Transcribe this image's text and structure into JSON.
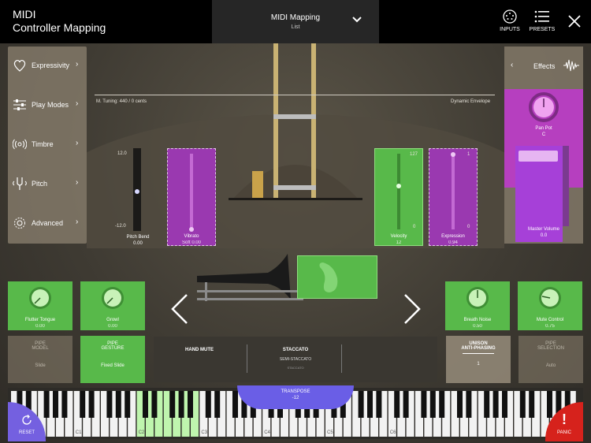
{
  "header": {
    "app_title_line1": "MIDI",
    "app_title_line2": "Controller Mapping",
    "mapping_title": "MIDI Mapping",
    "mapping_sub": "List",
    "inputs_label": "INPUTS",
    "presets_label": "PRESETS"
  },
  "sidebar": {
    "items": [
      {
        "label": "Expressivity",
        "icon": "heart-icon"
      },
      {
        "label": "Play Modes",
        "icon": "sliders-icon"
      },
      {
        "label": "Timbre",
        "icon": "broadcast-icon"
      },
      {
        "label": "Pitch",
        "icon": "tuning-fork-icon"
      },
      {
        "label": "Advanced",
        "icon": "gear-icon"
      }
    ]
  },
  "effects": {
    "title": "Effects",
    "pan_label": "Pan Pot",
    "pan_value": "C",
    "master_label": "Master Volume",
    "master_value": "0.0"
  },
  "stage": {
    "tuning": "M. Tuning: 440",
    "cents": "/ 0 cents",
    "dynamic_envelope": "Dynamic Envelope"
  },
  "sliders": {
    "pitch_bend": {
      "label": "Pitch Bend",
      "value": "0.00",
      "max": "12.0",
      "min": "-12.0",
      "level": 0.5
    },
    "vibrato": {
      "label": "Vibrato",
      "value": "Soft 0.00",
      "level": 0.0
    },
    "velocity": {
      "label": "Velocity",
      "value": "12",
      "max": "127",
      "min": "0",
      "level": 0.45
    },
    "expression": {
      "label": "Expression",
      "value": "0.94",
      "max": "1",
      "min": "0",
      "level": 0.94
    }
  },
  "knobs": {
    "flutter": {
      "label": "Flutter Tongue",
      "value": "0.00"
    },
    "growl": {
      "label": "Growl",
      "value": "0.00"
    },
    "breath": {
      "label": "Breath Noise",
      "value": "0.50"
    },
    "mute": {
      "label": "Mute Control",
      "value": "0.75"
    }
  },
  "pipes": {
    "model": {
      "line1": "PIPE",
      "line2": "MODEL",
      "value": "Slide"
    },
    "gesture": {
      "line1": "PIPE",
      "line2": "GESTURE",
      "value": "Fixed Slide"
    },
    "unison": {
      "line1": "UNISON",
      "line2": "ANTI-PHASING",
      "value": "1"
    },
    "selection": {
      "line1": "PIPE",
      "line2": "SELECTION",
      "value": "Auto"
    }
  },
  "articulation": {
    "hand_mute": "HAND MUTE",
    "staccato": "STACCATO",
    "semi_staccato": "SEMI-STACCATO",
    "staccato_small": "STACCATO"
  },
  "keyboard": {
    "transpose_label": "TRANSPOSE",
    "transpose_value": "-12",
    "octaves": [
      "C1",
      "C2",
      "C3",
      "C4",
      "C5",
      "C6"
    ],
    "reset_label": "RESET",
    "panic_label": "PANIC"
  },
  "colors": {
    "green": "#58b94a",
    "purple": "#b63fbf",
    "panic": "#d6221c",
    "reset": "#7460e0"
  }
}
